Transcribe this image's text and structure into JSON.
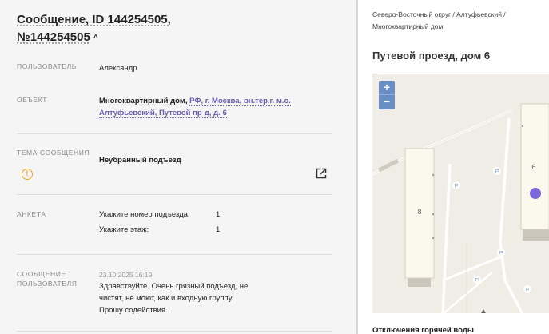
{
  "header": {
    "title_line1": "Сообщение, ID 144254505,",
    "title_line2": "№144254505"
  },
  "fields": {
    "user_label": "ПОЛЬЗОВАТЕЛЬ",
    "user_value": "Александр",
    "object_label": "ОБЪЕКТ",
    "object_prefix": "Многоквартирный дом,",
    "object_link": "РФ, г. Москва, вн.тер.г. м.о. Алтуфьевский, Путевой пр-д, д. 6",
    "topic_label": "ТЕМА СООБЩЕНИЯ",
    "topic_value": "Неубранный подъезд",
    "survey_label": "АНКЕТА",
    "survey_items": [
      {
        "question": "Укажите номер подъезда:",
        "answer": "1"
      },
      {
        "question": "Укажите этаж:",
        "answer": "1"
      }
    ],
    "message_label_1": "СООБЩЕНИЕ",
    "message_label_2": "ПОЛЬЗОВАТЕЛЯ",
    "message_date": "23.10.2025 16:19",
    "message_line1": "Здравствуйте. Очень грязный подъезд, не",
    "message_line2": "чистят, не моют, как и входную группу.",
    "message_line3": "Прошу содействия."
  },
  "sidebar": {
    "breadcrumb_1": "Северо-Восточный округ / Алтуфьевский /",
    "breadcrumb_2": "Многоквартирный дом",
    "address": "Путевой проезд, дом 6",
    "map": {
      "zoom_in": "+",
      "zoom_out": "−",
      "building_left_number": "8",
      "building_right_number": "6",
      "parking_symbol": "P",
      "marker_color": "#7b68d8"
    },
    "bottom_text": "Отключения горячей воды"
  },
  "colors": {
    "accent": "#6a5bb0",
    "warning": "#f5a31a",
    "map_bg": "#f0ede6",
    "zoom_bg": "#6a8ec4"
  }
}
